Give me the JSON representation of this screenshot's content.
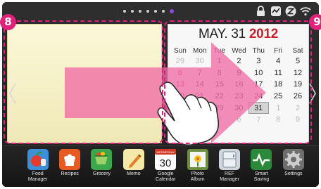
{
  "callouts": {
    "left": "8",
    "right": "9"
  },
  "calendar": {
    "month_day": "MAY. 31",
    "year": "2012",
    "weekdays": [
      "Sun",
      "Mon",
      "Tue",
      "Wed",
      "Thu",
      "Fri",
      "Sat"
    ],
    "weeks": [
      [
        "29",
        "30",
        "1",
        "2",
        "3",
        "4",
        "5"
      ],
      [
        "6",
        "7",
        "8",
        "9",
        "10",
        "11",
        "12"
      ],
      [
        "13",
        "14",
        "15",
        "16",
        "17",
        "18",
        "19"
      ],
      [
        "20",
        "21",
        "22",
        "23",
        "24",
        "25",
        "26"
      ],
      [
        "27",
        "28",
        "29",
        "30",
        "31",
        "1",
        "2"
      ],
      [
        "3",
        "4",
        "5",
        "6",
        "7",
        "8",
        "9"
      ]
    ],
    "today": "31"
  },
  "calendar_icon": {
    "banner": "WEDNESDAY",
    "day": "30"
  },
  "page_indicator": {
    "count": 7,
    "active_index": 6
  },
  "status_icons": [
    "lock-icon",
    "sync-icon",
    "z-icon",
    "wifi-icon"
  ],
  "dock": {
    "apps": [
      {
        "label": "Food\nManager",
        "icon": "food-manager-icon"
      },
      {
        "label": "Recipes",
        "icon": "recipes-icon"
      },
      {
        "label": "Grocery",
        "icon": "grocery-icon"
      },
      {
        "label": "Memo",
        "icon": "memo-icon"
      },
      {
        "label": "Google\nCalendar",
        "icon": "google-calendar-icon"
      },
      {
        "label": "Photo\nAlbum",
        "icon": "photo-album-icon"
      },
      {
        "label": "REF\nManager",
        "icon": "ref-manager-icon"
      },
      {
        "label": "Smart\nSaving",
        "icon": "smart-saving-icon"
      },
      {
        "label": "Settings",
        "icon": "settings-icon"
      }
    ]
  },
  "colors": {
    "accent_pink": "#e0227a",
    "active_dot": "#8a4bd6",
    "calendar_red": "#c8202e"
  }
}
